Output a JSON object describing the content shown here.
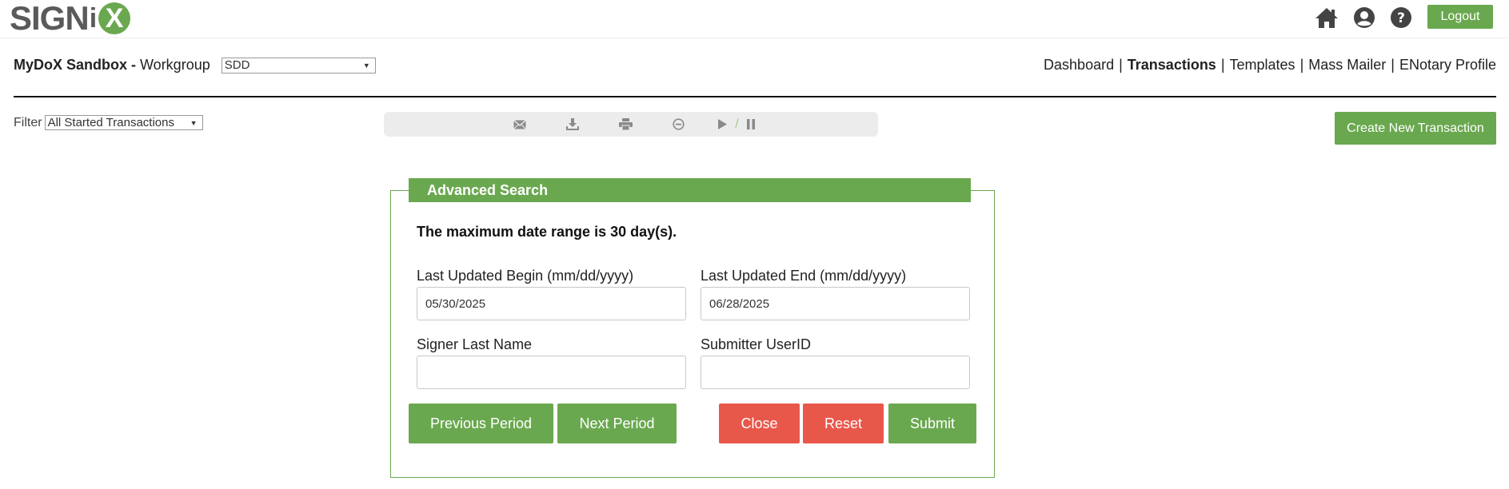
{
  "logo": {
    "text": "SIGN",
    "mark": "X"
  },
  "header_icons": [
    "home-icon",
    "user-circle-icon",
    "help-circle-icon"
  ],
  "logout_label": "Logout",
  "title": {
    "app": "MyDoX Sandbox",
    "dash": "-",
    "workgroup_label": "Workgroup",
    "workgroup_value": "SDD"
  },
  "nav": {
    "items": [
      {
        "label": "Dashboard",
        "active": false
      },
      {
        "label": "Transactions",
        "active": true
      },
      {
        "label": "Templates",
        "active": false
      },
      {
        "label": "Mass Mailer",
        "active": false
      },
      {
        "label": "ENotary Profile",
        "active": false
      }
    ],
    "separator": "|"
  },
  "filter": {
    "label": "Filter",
    "value": "All Started Transactions"
  },
  "toolbar": {
    "icons": [
      "envelope-icon",
      "download-icon",
      "print-icon",
      "minus-circle-icon",
      "play-icon",
      "pause-icon"
    ],
    "slash": "/"
  },
  "create_label": "Create New Transaction",
  "advanced_search": {
    "title": "Advanced Search",
    "note": "The maximum date range is 30 day(s).",
    "fields": {
      "begin_label": "Last Updated Begin (mm/dd/yyyy)",
      "begin_value": "05/30/2025",
      "end_label": "Last Updated End (mm/dd/yyyy)",
      "end_value": "06/28/2025",
      "signer_label": "Signer Last Name",
      "signer_value": "",
      "submitter_label": "Submitter UserID",
      "submitter_value": ""
    },
    "buttons": {
      "previous": "Previous Period",
      "next": "Next Period",
      "close": "Close",
      "reset": "Reset",
      "submit": "Submit"
    }
  },
  "colors": {
    "brand_green": "#6aa84f",
    "danger_red": "#e8584a",
    "toolbar_bg": "#ececec"
  }
}
